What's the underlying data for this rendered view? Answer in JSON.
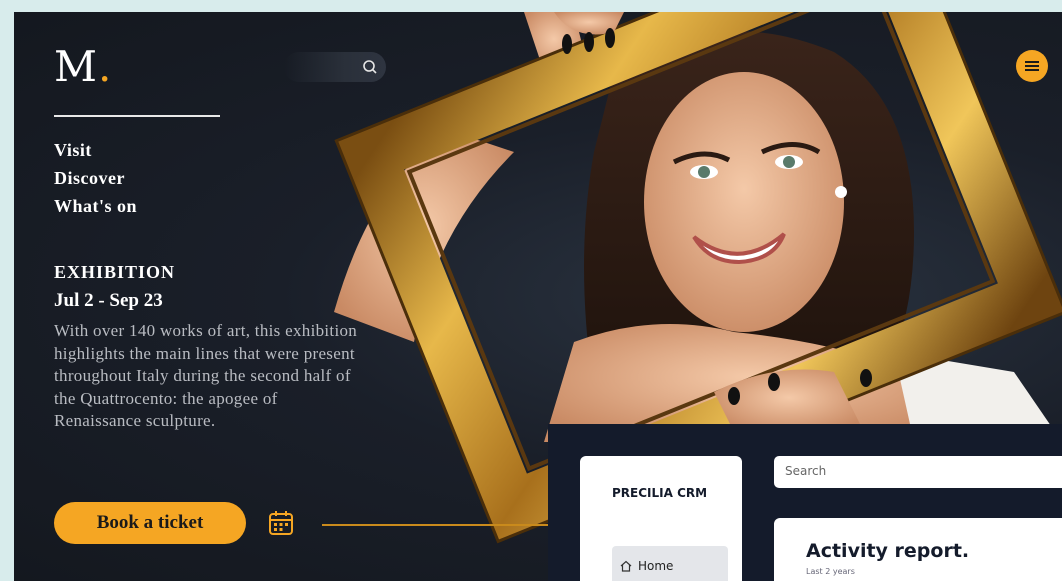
{
  "museum": {
    "logo": {
      "letter": "M",
      "dot": "."
    },
    "nav": [
      "Visit",
      "Discover",
      "What's on"
    ],
    "exhibition": {
      "label": "EXHIBITION",
      "dates": "Jul 2 - Sep 23",
      "description": "With over 140 works of art, this exhibition highlights the main lines that were present throughout Italy during the second half of the Quattrocento: the apogee of Renaissance sculpture."
    },
    "book_label": "Book a ticket",
    "icons": {
      "search": "search-icon",
      "menu": "hamburger-icon",
      "calendar": "calendar-icon"
    },
    "colors": {
      "accent": "#f5a623",
      "background": "#1a1f29",
      "frame_gold": "#c8962e"
    }
  },
  "crm": {
    "brand": "PRECILIA CRM",
    "home_label": "Home",
    "search_placeholder": "Search",
    "report_title": "Activity report.",
    "report_subtitle": "Last 2 years",
    "icons": {
      "home": "home-icon"
    }
  }
}
